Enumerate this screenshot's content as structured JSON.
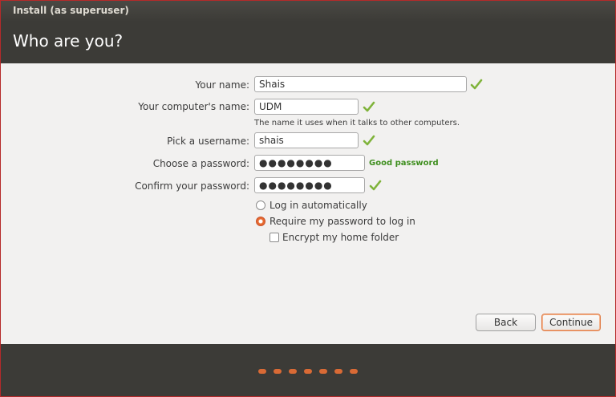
{
  "window": {
    "title": "Install (as superuser)"
  },
  "header": {
    "title": "Who are you?"
  },
  "form": {
    "name": {
      "label": "Your name:",
      "value": "Shais"
    },
    "computer": {
      "label": "Your computer's name:",
      "value": "UDM",
      "hint": "The name it uses when it talks to other computers."
    },
    "username": {
      "label": "Pick a username:",
      "value": "shais"
    },
    "password": {
      "label": "Choose a password:",
      "value": "●●●●●●●●",
      "strength": "Good password"
    },
    "confirm": {
      "label": "Confirm your password:",
      "value": "●●●●●●●●"
    },
    "options": {
      "auto_login": "Log in automatically",
      "require_password": "Require my password to log in",
      "encrypt_home": "Encrypt my home folder"
    }
  },
  "buttons": {
    "back": "Back",
    "continue": "Continue"
  },
  "colors": {
    "accent": "#e7692f",
    "success": "#3f8f1f",
    "dark_bg": "#3c3b37"
  },
  "progress": {
    "steps_total": 7
  }
}
